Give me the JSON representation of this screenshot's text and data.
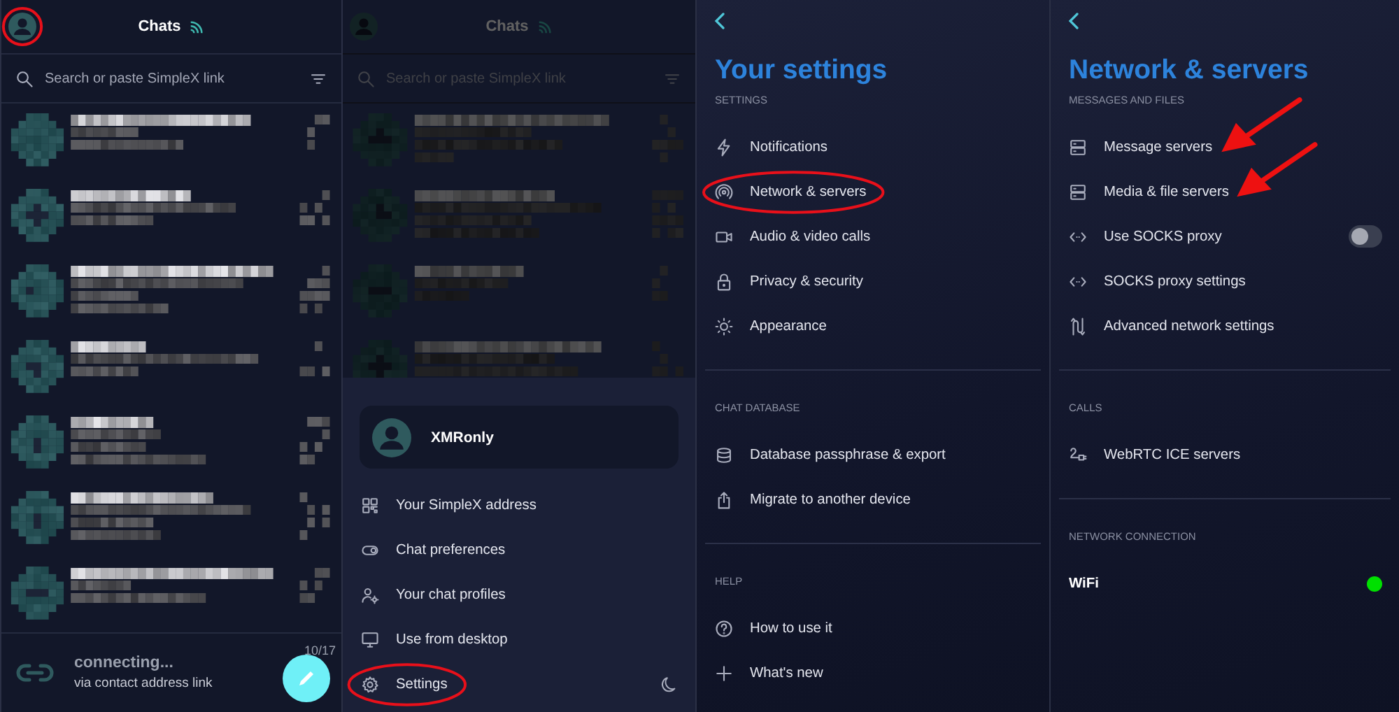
{
  "chats_screen": {
    "header": {
      "title": "Chats",
      "avatar_highlighted": true
    },
    "search": {
      "placeholder": "Search or paste SimpleX link"
    },
    "rows": [
      {
        "kind": "redacted"
      },
      {
        "kind": "redacted"
      },
      {
        "kind": "redacted"
      },
      {
        "kind": "redacted"
      },
      {
        "kind": "redacted"
      },
      {
        "kind": "redacted"
      },
      {
        "kind": "redacted"
      }
    ],
    "pending": {
      "title": "connecting...",
      "subtitle": "via contact address link",
      "time": "10/17"
    }
  },
  "drawer_screen": {
    "header": {
      "title": "Chats",
      "avatar_highlighted": false
    },
    "search": {
      "placeholder": "Search or paste SimpleX link"
    },
    "rows": [
      {
        "kind": "redacted"
      },
      {
        "kind": "redacted"
      },
      {
        "kind": "redacted"
      },
      {
        "kind": "redacted"
      }
    ],
    "profile": {
      "name": "XMRonly"
    },
    "menu": [
      {
        "label": "Your SimpleX address",
        "highlighted": false
      },
      {
        "label": "Chat preferences",
        "highlighted": false
      },
      {
        "label": "Your chat profiles",
        "highlighted": false
      },
      {
        "label": "Use from desktop",
        "highlighted": false
      },
      {
        "label": "Settings",
        "highlighted": true
      }
    ]
  },
  "settings_screen": {
    "title": "Your settings",
    "sections": [
      {
        "heading": "SETTINGS",
        "items": [
          {
            "label": "Notifications",
            "highlighted": false
          },
          {
            "label": "Network & servers",
            "highlighted": true
          },
          {
            "label": "Audio & video calls",
            "highlighted": false
          },
          {
            "label": "Privacy & security",
            "highlighted": false
          },
          {
            "label": "Appearance",
            "highlighted": false
          }
        ]
      },
      {
        "heading": "CHAT DATABASE",
        "items": [
          {
            "label": "Database passphrase & export",
            "highlighted": false
          },
          {
            "label": "Migrate to another device",
            "highlighted": false
          }
        ]
      },
      {
        "heading": "HELP",
        "items": [
          {
            "label": "How to use it",
            "highlighted": false
          },
          {
            "label": "What's new",
            "highlighted": false
          }
        ]
      }
    ]
  },
  "network_screen": {
    "title": "Network & servers",
    "sections": [
      {
        "heading": "MESSAGES AND FILES",
        "items": [
          {
            "label": "Message servers",
            "kind": "link",
            "arrow": true
          },
          {
            "label": "Media & file servers",
            "kind": "link",
            "arrow": true
          },
          {
            "label": "Use SOCKS proxy",
            "kind": "toggle",
            "on": false,
            "arrow": false
          },
          {
            "label": "SOCKS proxy settings",
            "kind": "link",
            "arrow": false
          },
          {
            "label": "Advanced network settings",
            "kind": "link",
            "arrow": false
          }
        ]
      },
      {
        "heading": "CALLS",
        "items": [
          {
            "label": "WebRTC ICE servers",
            "kind": "link",
            "arrow": false
          }
        ]
      },
      {
        "heading": "NETWORK CONNECTION",
        "items": [
          {
            "label": "WiFi",
            "kind": "status",
            "color": "#00e000",
            "arrow": false
          }
        ]
      }
    ]
  }
}
